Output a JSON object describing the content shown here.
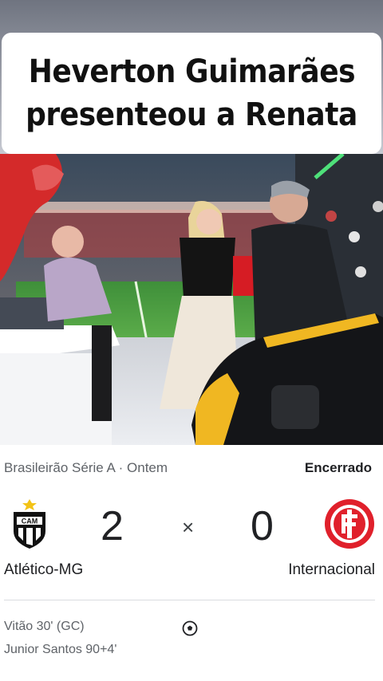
{
  "headline": {
    "line1": "Heverton Guimarães",
    "line2": "presenteou a Renata"
  },
  "match": {
    "competition": "Brasileirão Série A · Ontem",
    "status": "Encerrado",
    "home": {
      "name": "Atlético-MG",
      "score": "2",
      "logo": "atletico-mg-crest-icon"
    },
    "away": {
      "name": "Internacional",
      "score": "0",
      "logo": "internacional-crest-icon"
    },
    "separator": "×",
    "scorers": [
      "Vitão 30' (GC)",
      "Junior Santos 90+4'"
    ],
    "scorer_icon": "soccer-ball-icon"
  },
  "colors": {
    "home_crest": "#111111",
    "away_crest": "#e0202b",
    "headline_bg": "#ffffff"
  }
}
